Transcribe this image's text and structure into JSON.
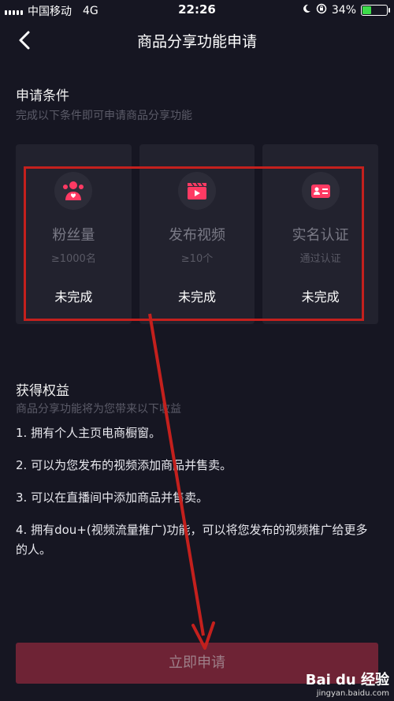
{
  "status_bar": {
    "carrier": "中国移动",
    "network": "4G",
    "time": "22:26",
    "battery_percent": "34%",
    "battery_color": "#3ddc4a"
  },
  "nav": {
    "back_icon": "chevron-left-icon",
    "title": "商品分享功能申请"
  },
  "conditions": {
    "title": "申请条件",
    "subtitle": "完成以下条件即可申请商品分享功能",
    "cards": [
      {
        "icon": "fans-icon",
        "name": "粉丝量",
        "requirement": "≥1000名",
        "status": "未完成"
      },
      {
        "icon": "video-clapper-icon",
        "name": "发布视频",
        "requirement": "≥10个",
        "status": "未完成"
      },
      {
        "icon": "id-card-icon",
        "name": "实名认证",
        "requirement": "通过认证",
        "status": "未完成"
      }
    ]
  },
  "benefits": {
    "title": "获得权益",
    "subtitle": "商品分享功能将为您带来以下收益",
    "items": [
      "1. 拥有个人主页电商橱窗。",
      "2. 可以为您发布的视频添加商品并售卖。",
      "3. 可以在直播间中添加商品并售卖。",
      "4. 拥有dou+(视频流量推广)功能，可以将您发布的视频推广给更多的人。"
    ]
  },
  "apply_button": "立即申请",
  "annotation_color": "#c4201d",
  "watermark": {
    "brand": "Bai du 经验",
    "url": "jingyan.baidu.com"
  }
}
